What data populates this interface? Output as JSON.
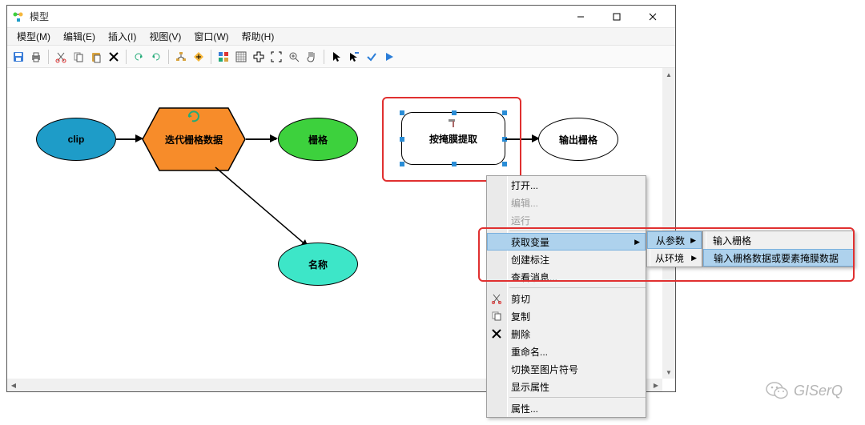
{
  "window": {
    "title": "模型",
    "controls": {
      "minimize": "",
      "maximize": "",
      "close": ""
    }
  },
  "menubar": {
    "items": [
      "模型(M)",
      "编辑(E)",
      "插入(I)",
      "视图(V)",
      "窗口(W)",
      "帮助(H)"
    ]
  },
  "toolbar_icons": [
    "save",
    "print",
    "cut",
    "copy",
    "paste",
    "delete",
    "undo",
    "redo",
    "fit",
    "add",
    "grid1",
    "grid2",
    "cross",
    "fullscreen",
    "zoom-in",
    "pan",
    "pointer",
    "info",
    "check",
    "play"
  ],
  "nodes": {
    "clip": "clip",
    "iterate": "迭代栅格数据",
    "raster": "栅格",
    "name": "名称",
    "extract": "按掩膜提取",
    "output": "输出栅格"
  },
  "context_menu": {
    "open": "打开...",
    "edit": "编辑...",
    "run": "运行",
    "get_var": "获取变量",
    "create_label": "创建标注",
    "view_msg": "查看消息...",
    "cut": "剪切",
    "copy": "复制",
    "delete": "删除",
    "rename": "重命名...",
    "switch_symbol": "切换至图片符号",
    "show_props": "显示属性",
    "props": "属性..."
  },
  "submenu1": {
    "from_param": "从参数",
    "from_env": "从环境"
  },
  "submenu2": {
    "input_raster": "输入栅格",
    "input_mask": "输入栅格数据或要素掩膜数据"
  },
  "watermark": "GISerQ"
}
